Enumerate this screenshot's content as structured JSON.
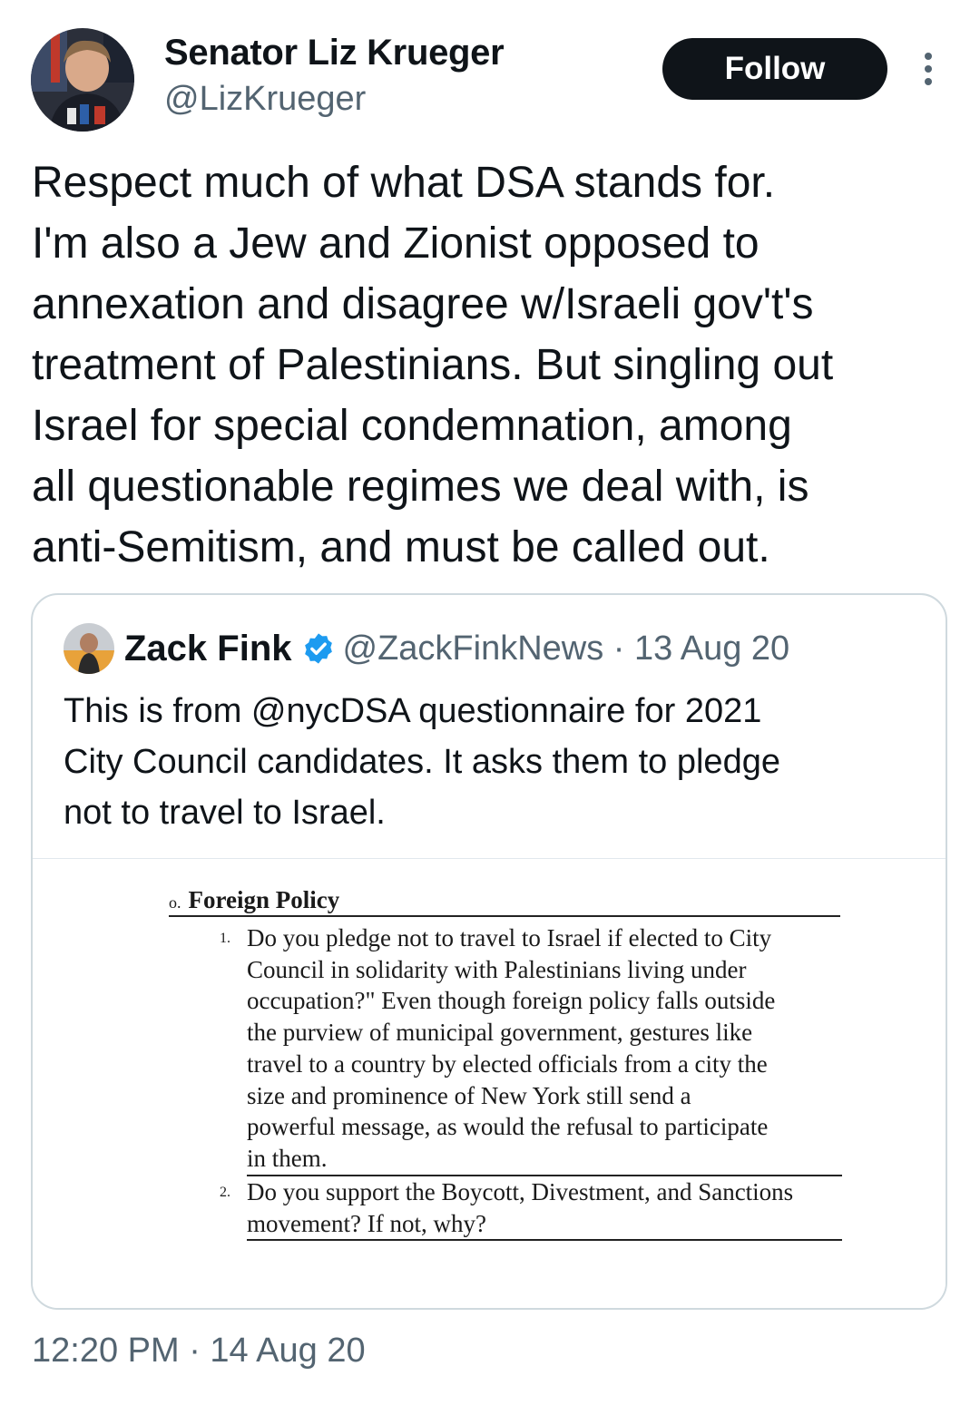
{
  "author": {
    "display_name": "Senator Liz Krueger",
    "handle": "@LizKrueger"
  },
  "follow_label": "Follow",
  "tweet_text": "Respect much of what DSA stands for.\nI'm also a Jew and Zionist opposed to\nannexation and disagree w/Israeli gov't's\ntreatment of Palestinians. But singling out\nIsrael for special condemnation, among\nall questionable regimes we deal with, is\nanti-Semitism, and must be called out.",
  "quoted": {
    "display_name": "Zack Fink",
    "meta": "@ZackFinkNews · 13 Aug 20",
    "text": "This is from @nycDSA questionnaire for 2021\nCity Council candidates. It asks them to pledge\nnot to travel to Israel.",
    "document": {
      "section_marker": "o.",
      "section_title": "Foreign Policy",
      "questions": [
        {
          "number": "1.",
          "text": "Do you pledge not to travel to Israel if elected to City\nCouncil in solidarity with Palestinians living under\noccupation?\" Even though foreign policy falls outside\nthe purview of municipal government, gestures like\ntravel to a country by elected officials from a city the\nsize and prominence of New York still send a\npowerful message, as would the refusal to participate\nin them."
        },
        {
          "number": "2.",
          "text": "Do you support the Boycott, Divestment, and Sanctions\nmovement? If not, why?"
        }
      ]
    }
  },
  "timestamp": "12:20 PM · 14 Aug 20"
}
